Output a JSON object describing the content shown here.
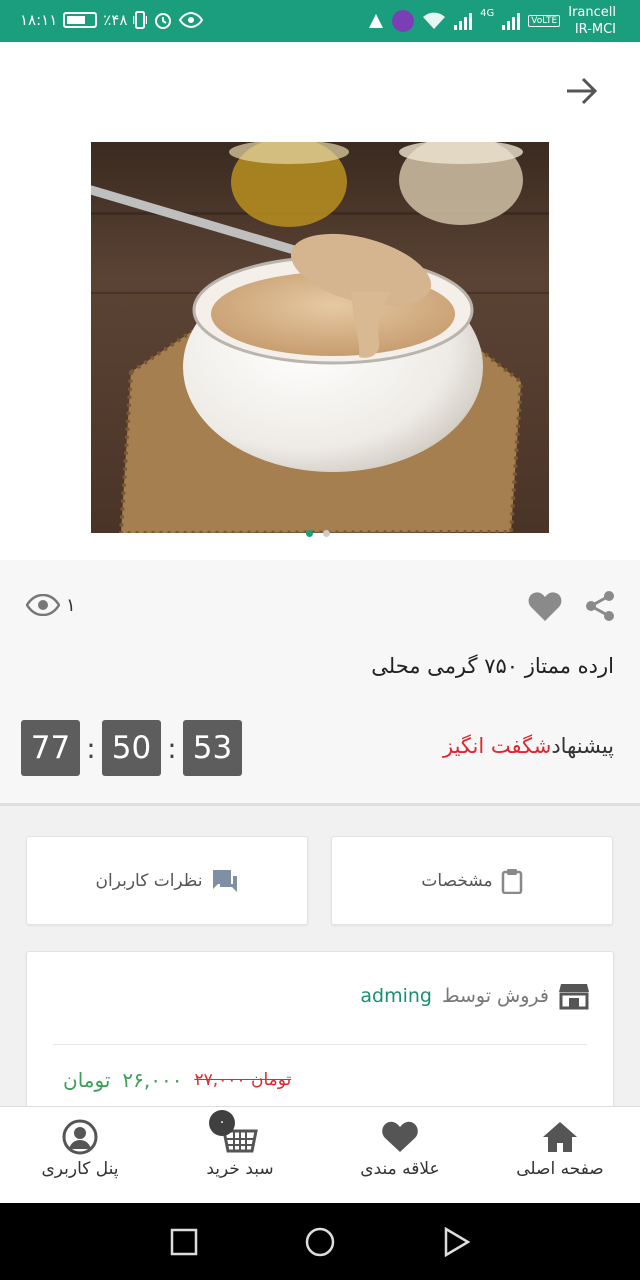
{
  "status_bar": {
    "time": "۱۸:۱۱",
    "battery": "٪۴۸",
    "network": "4G",
    "volte": "VoLTE",
    "carrier_1": "Irancell",
    "carrier_2": "IR-MCI"
  },
  "product": {
    "title": "ارده ممتاز ۷۵۰ گرمی محلی",
    "views": "۱",
    "image_icon": "tahini-bowl-photo",
    "slide_count": 2,
    "active_slide": 1
  },
  "offer": {
    "label_prefix": "پیشنهاد",
    "label_highlight": "شگفت انگیز",
    "timer": [
      "77",
      "50",
      "53"
    ],
    "timer_separator": ":"
  },
  "tabs": {
    "specs": "مشخصات",
    "reviews": "نظرات کاربران"
  },
  "seller": {
    "sold_by": "فروش توسط",
    "name": "adming"
  },
  "price": {
    "new_value": "۲۶,۰۰۰",
    "new_currency": "تومان",
    "old": "۲۷,۰۰۰ تومان"
  },
  "bottom_nav": {
    "home": "صفحه اصلی",
    "favorites": "علاقه مندی",
    "cart": "سبد خرید",
    "cart_badge": "۰",
    "profile": "پنل کاربری"
  },
  "colors": {
    "accent": "#1b9e7e",
    "offer_red": "#e0262f",
    "price_green": "#3aa157"
  }
}
